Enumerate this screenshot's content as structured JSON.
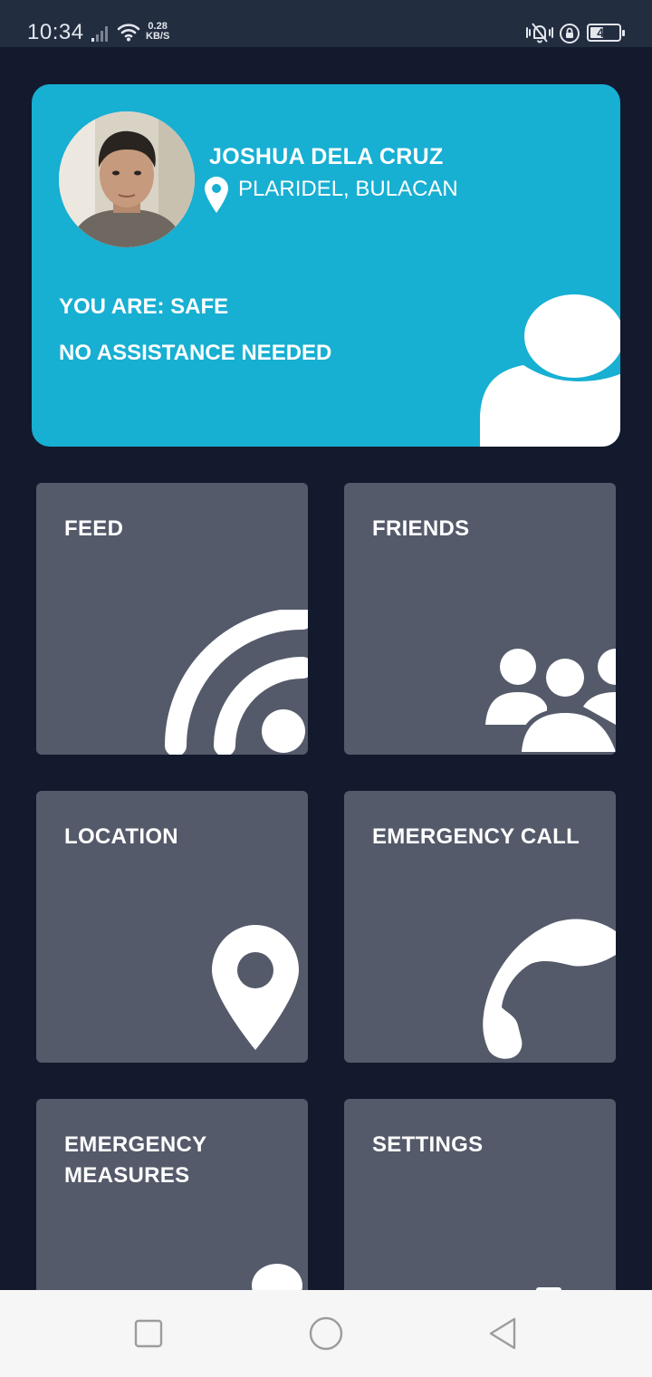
{
  "status_bar": {
    "time": "10:34",
    "speed_value": "0.28",
    "speed_unit": "KB/S",
    "battery": "42",
    "battery_level": 0.42,
    "icons": [
      "signal-icon",
      "wifi-icon",
      "vibrate-icon",
      "rotation-lock-icon",
      "battery-icon"
    ]
  },
  "profile": {
    "name": "JOSHUA DELA CRUZ",
    "location": "PLARIDEL, BULACAN",
    "status_line": "YOU ARE: SAFE",
    "assistance_line": "NO ASSISTANCE NEEDED",
    "card_color": "#17afd2"
  },
  "tiles": [
    {
      "label": "FEED",
      "icon": "rss-feed-icon"
    },
    {
      "label": "FRIENDS",
      "icon": "friends-group-icon"
    },
    {
      "label": "LOCATION",
      "icon": "location-pin-icon"
    },
    {
      "label": "EMERGENCY CALL",
      "icon": "phone-icon"
    },
    {
      "label": "EMERGENCY\nMEASURES",
      "icon": "running-person-icon"
    },
    {
      "label": "SETTINGS",
      "icon": "gear-icon"
    }
  ],
  "tile_color": "#545a6a",
  "background_color": "#141a2d",
  "nav_bar": {
    "icons": [
      "recents-square-icon",
      "home-circle-icon",
      "back-triangle-icon"
    ]
  }
}
